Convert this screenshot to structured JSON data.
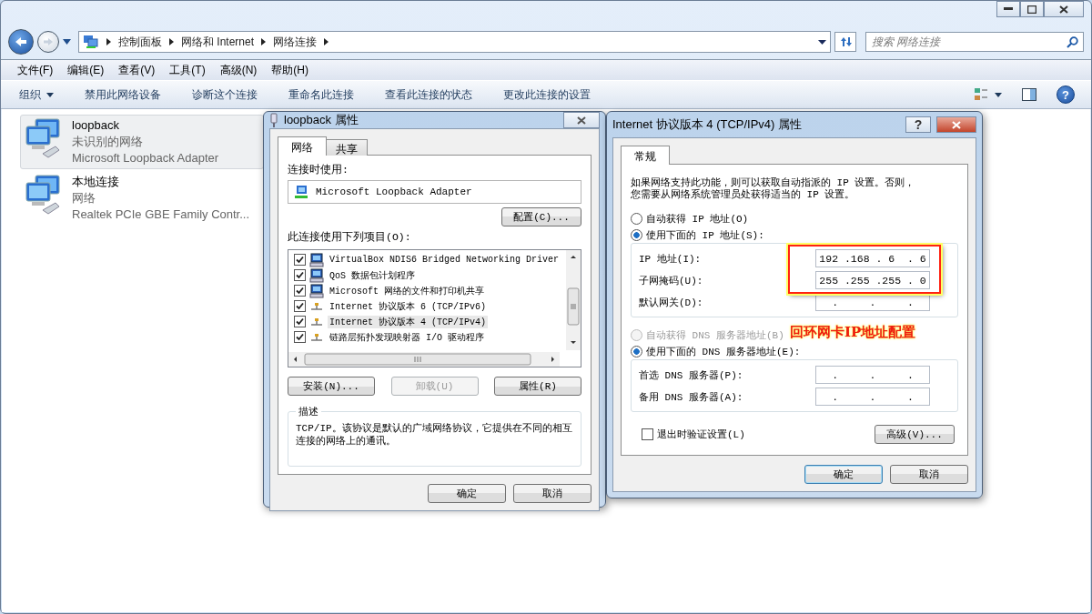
{
  "address_bar": {
    "crumbs": [
      "控制面板",
      "网络和 Internet",
      "网络连接"
    ]
  },
  "search": {
    "placeholder": "搜索 网络连接"
  },
  "help_button": "?",
  "menu_bar": [
    "文件(F)",
    "编辑(E)",
    "查看(V)",
    "工具(T)",
    "高级(N)",
    "帮助(H)"
  ],
  "toolbar": [
    {
      "label": "组织",
      "kind": "dropdown"
    },
    {
      "label": "禁用此网络设备",
      "kind": "plain"
    },
    {
      "label": "诊断这个连接",
      "kind": "plain"
    },
    {
      "label": "重命名此连接",
      "kind": "plain"
    },
    {
      "label": "查看此连接的状态",
      "kind": "plain"
    },
    {
      "label": "更改此连接的设置",
      "kind": "plain"
    }
  ],
  "connections": [
    {
      "name": "loopback",
      "status": "未识别的网络",
      "adapter": "Microsoft Loopback Adapter",
      "selected": true
    },
    {
      "name": "本地连接",
      "status": "网络",
      "adapter": "Realtek PCIe GBE Family Contr...",
      "selected": false
    }
  ],
  "properties_dialog": {
    "title": "loopback 属性",
    "tabs": [
      {
        "label": "网络",
        "selected": true
      },
      {
        "label": "共享",
        "selected": false
      }
    ],
    "connect_using_label": "连接时使用:",
    "adapter": "Microsoft Loopback Adapter",
    "configure_button": "配置(C)...",
    "items_label": "此连接使用下列项目(O):",
    "items": [
      {
        "label": "VirtualBox NDIS6 Bridged Networking Driver",
        "kind": "service",
        "checked": true,
        "selected": false
      },
      {
        "label": "QoS 数据包计划程序",
        "kind": "service",
        "checked": true,
        "selected": false
      },
      {
        "label": "Microsoft 网络的文件和打印机共享",
        "kind": "service",
        "checked": true,
        "selected": false
      },
      {
        "label": "Internet 协议版本 6 (TCP/IPv6)",
        "kind": "protocol",
        "checked": true,
        "selected": false
      },
      {
        "label": "Internet 协议版本 4 (TCP/IPv4)",
        "kind": "protocol",
        "checked": true,
        "selected": true
      },
      {
        "label": "链路层拓扑发现映射器 I/O 驱动程序",
        "kind": "protocol",
        "checked": true,
        "selected": false
      }
    ],
    "buttons": [
      {
        "label": "安装(N)...",
        "disabled": false
      },
      {
        "label": "卸载(U)",
        "disabled": true
      },
      {
        "label": "属性(R)",
        "disabled": false
      }
    ],
    "description_title": "描述",
    "description": "TCP/IP。该协议是默认的广域网络协议，它提供在不同的相互连接的网络上的通讯。",
    "footer_buttons": [
      {
        "label": "确定",
        "default": false
      },
      {
        "label": "取消",
        "default": false
      }
    ]
  },
  "ipv4_dialog": {
    "title": "Internet 协议版本 4 (TCP/IPv4) 属性",
    "tabs": [
      {
        "label": "常规",
        "selected": true
      }
    ],
    "intro": "如果网络支持此功能，则可以获取自动指派的 IP 设置。否则，您需要从网络系统管理员处获得适当的 IP 设置。",
    "ip_options": [
      {
        "label": "自动获得 IP 地址(O)",
        "selected": false,
        "disabled": false
      },
      {
        "label": "使用下面的 IP 地址(S):",
        "selected": true,
        "disabled": false
      }
    ],
    "help_button": "?",
    "ip_fields": [
      {
        "label": "IP 地址(I):",
        "value": "192 .168 . 6  . 6"
      },
      {
        "label": "子网掩码(U):",
        "value": "255 .255 .255 . 0"
      },
      {
        "label": "默认网关(D):",
        "value": ".     .     ."
      }
    ],
    "dns_options": [
      {
        "label": "自动获得 DNS 服务器地址(B)",
        "selected": false,
        "disabled": true
      },
      {
        "label": "使用下面的 DNS 服务器地址(E):",
        "selected": true,
        "disabled": false
      }
    ],
    "dns_fields": [
      {
        "label": "首选 DNS 服务器(P):",
        "value": ".     .     ."
      },
      {
        "label": "备用 DNS 服务器(A):",
        "value": ".     .     ."
      }
    ],
    "validate": {
      "label": "退出时验证设置(L)",
      "checked": false
    },
    "advanced_button": "高级(V)...",
    "footer_buttons": [
      {
        "label": "确定",
        "default": true
      },
      {
        "label": "取消",
        "default": false
      }
    ]
  },
  "annotation": {
    "text": "回环网卡IP地址配置"
  }
}
